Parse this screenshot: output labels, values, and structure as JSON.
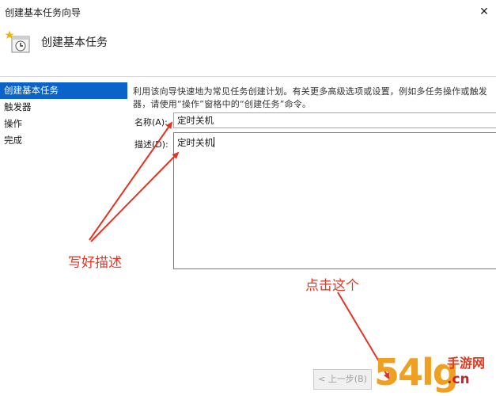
{
  "window": {
    "title": "创建基本任务向导",
    "close_glyph": "✕"
  },
  "header": {
    "title": "创建基本任务",
    "icon": "task-wizard-icon"
  },
  "sidebar": {
    "steps": [
      {
        "label": "创建基本任务",
        "active": true
      },
      {
        "label": "触发器"
      },
      {
        "label": "操作"
      },
      {
        "label": "完成"
      }
    ]
  },
  "main": {
    "description_line1": "利用该向导快速地为常见任务创建计划。有关更多高级选项或设置，例如多任务操作或触发",
    "description_line2": "器，请使用“操作”窗格中的“创建任务”命令。",
    "name_label": "名称(A):",
    "name_value": "定时关机",
    "desc_label": "描述(D):",
    "desc_value": "定时关机"
  },
  "annotations": {
    "write_desc": "写好描述",
    "click_this": "点击这个",
    "color": "#e33423"
  },
  "footer": {
    "back_button": "< 上一步(B)"
  },
  "watermark": {
    "digits": "54lg",
    "game": "手游网",
    "url": ".cn"
  }
}
